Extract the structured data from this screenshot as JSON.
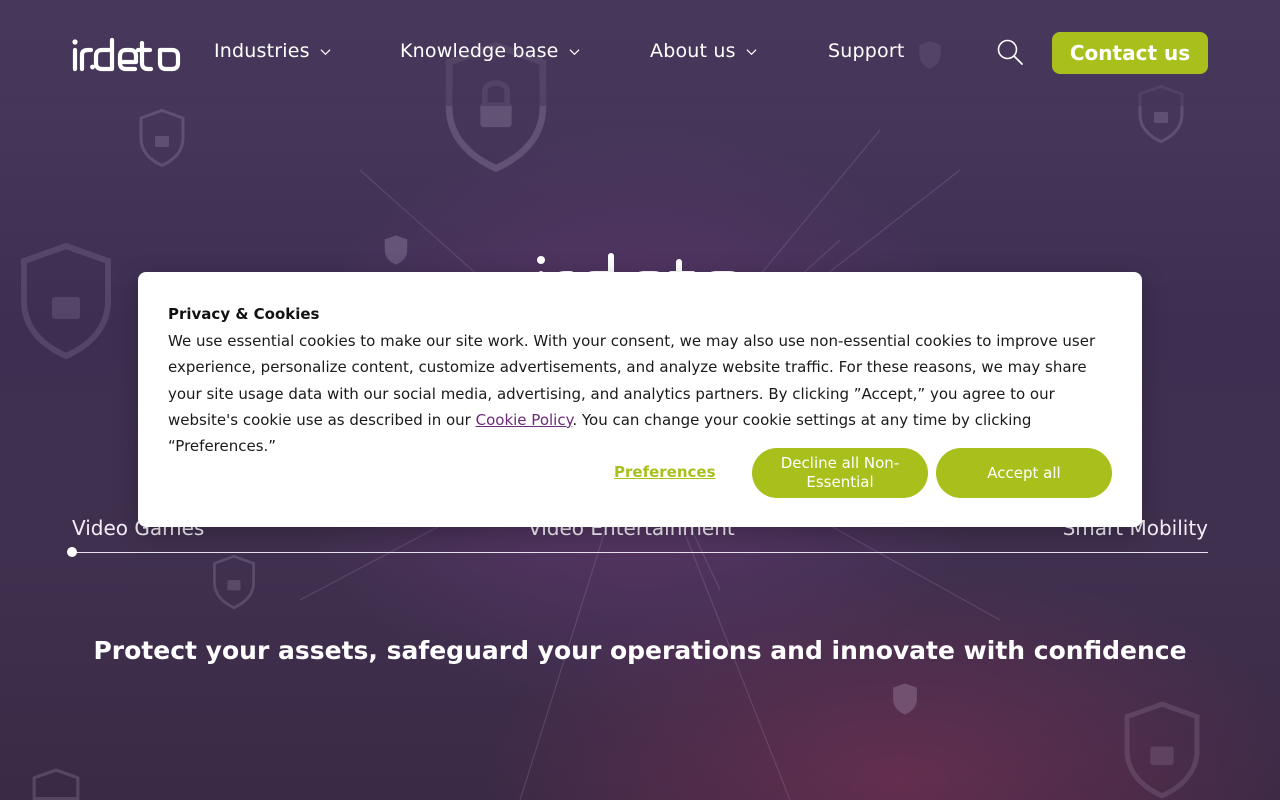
{
  "header": {
    "logo_text": "irdeto",
    "nav": [
      {
        "label": "Industries"
      },
      {
        "label": "Knowledge base"
      },
      {
        "label": "About us"
      },
      {
        "label": "Support"
      }
    ],
    "contact_label": "Contact us"
  },
  "hero": {
    "logo_text": "irdeto",
    "slider_labels": [
      "Video Games",
      "Video Entertainment",
      "Smart Mobility"
    ],
    "tagline": "Protect your assets, safeguard your operations and innovate with confidence"
  },
  "cookie": {
    "title": "Privacy & Cookies",
    "text_before_link": "We use essential cookies to make our site work. With your consent, we may also use non-essential cookies to improve user experience, personalize content, customize advertisements, and analyze website traffic. For these reasons, we may share your site usage data with our social media, advertising, and analytics partners. By clicking ”Accept,” you agree to our website's cookie use as described in our ",
    "link_text": "Cookie Policy",
    "text_after_link": ". You can change your cookie settings at any time by clicking “Preferences.”",
    "preferences_label": "Preferences",
    "decline_label": "Decline all Non-Essential",
    "accept_label": "Accept all"
  },
  "colors": {
    "accent": "#a9c01c",
    "link": "#6b2b77",
    "background": "#43345a"
  }
}
